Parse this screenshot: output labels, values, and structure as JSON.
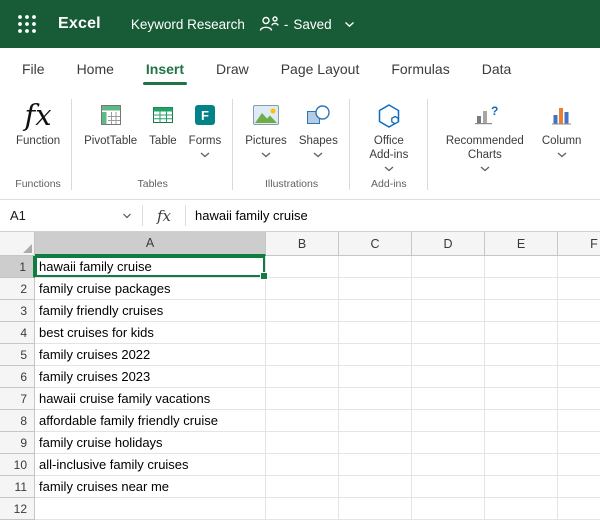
{
  "top_bar": {
    "app_name": "Excel",
    "document_title": "Keyword Research",
    "saved_separator": "-",
    "saved_status": "Saved"
  },
  "ribbon": {
    "tabs": [
      {
        "label": "File"
      },
      {
        "label": "Home"
      },
      {
        "label": "Insert",
        "active": true
      },
      {
        "label": "Draw"
      },
      {
        "label": "Page Layout"
      },
      {
        "label": "Formulas"
      },
      {
        "label": "Data"
      }
    ],
    "groups": [
      {
        "label": "Functions",
        "buttons": [
          {
            "label": "Function",
            "icon_text": "fx"
          }
        ]
      },
      {
        "label": "Tables",
        "buttons": [
          {
            "label": "PivotTable"
          },
          {
            "label": "Table"
          },
          {
            "label": "Forms",
            "dropdown": true
          }
        ]
      },
      {
        "label": "Illustrations",
        "buttons": [
          {
            "label": "Pictures",
            "dropdown": true
          },
          {
            "label": "Shapes",
            "dropdown": true
          }
        ]
      },
      {
        "label": "Add-ins",
        "buttons": [
          {
            "label": "Office Add-ins",
            "dropdown": true
          }
        ]
      },
      {
        "label": "",
        "buttons": [
          {
            "label": "Recommended Charts",
            "dropdown": true
          },
          {
            "label": "Column",
            "dropdown": true
          }
        ]
      }
    ],
    "forms_icon_letter": "F",
    "recommended_charts_question": "?"
  },
  "formula_bar": {
    "name_box": "A1",
    "fx": "fx",
    "value": "hawaii family cruise"
  },
  "grid": {
    "selected_cell": "A1",
    "columns": [
      "A",
      "B",
      "C",
      "D",
      "E",
      "F"
    ],
    "rows": [
      {
        "n": "1",
        "A": "hawaii family cruise"
      },
      {
        "n": "2",
        "A": "family cruise packages"
      },
      {
        "n": "3",
        "A": "family friendly cruises"
      },
      {
        "n": "4",
        "A": "best cruises for kids"
      },
      {
        "n": "5",
        "A": "family cruises 2022"
      },
      {
        "n": "6",
        "A": "family cruises 2023"
      },
      {
        "n": "7",
        "A": "hawaii cruise family vacations"
      },
      {
        "n": "8",
        "A": "affordable family friendly cruise"
      },
      {
        "n": "9",
        "A": "family cruise holidays"
      },
      {
        "n": "10",
        "A": "all-inclusive family cruises"
      },
      {
        "n": "11",
        "A": "family cruises near me"
      },
      {
        "n": "12",
        "A": ""
      }
    ]
  },
  "colors": {
    "titlebar_green": "#185C37",
    "accent_green": "#217346",
    "selection_green": "#107C41"
  },
  "icons": {
    "app_launcher": "waffle-icon",
    "collaboration": "people-icon",
    "title_menu": "chevron-down-icon",
    "name_box_menu": "chevron-down-icon",
    "select_all": "corner-triangle-icon"
  }
}
